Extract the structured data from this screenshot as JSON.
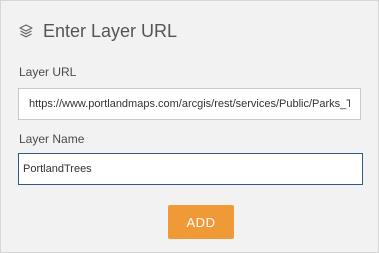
{
  "dialog": {
    "title": "Enter Layer URL",
    "header_icon": "layers-icon"
  },
  "form": {
    "url_label": "Layer URL",
    "url_value": "https://www.portlandmaps.com/arcgis/rest/services/Public/Parks_Tree_Inventory/MapServer",
    "name_label": "Layer Name",
    "name_value": "PortlandTrees"
  },
  "actions": {
    "add_label": "ADD"
  },
  "colors": {
    "panel_background": "#f2f2f2",
    "accent_button": "#ef9a37",
    "focused_border": "#2e5a8a"
  }
}
